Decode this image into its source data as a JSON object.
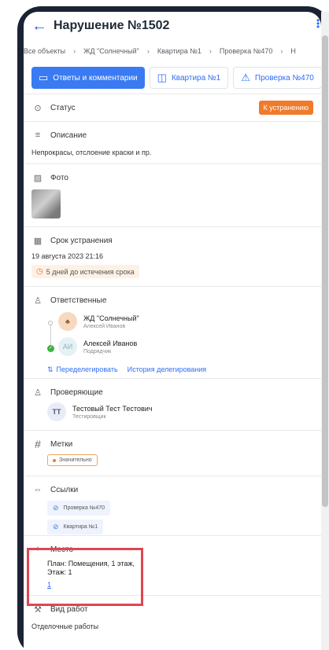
{
  "header": {
    "title": "Нарушение №1502"
  },
  "breadcrumb": [
    "Все объекты",
    "ЖД \"Солнечный\"",
    "Квартира №1",
    "Проверка №470",
    "Н"
  ],
  "tabs": [
    {
      "label": "Ответы и комментарии",
      "icon": "comment-icon"
    },
    {
      "label": "Квартира №1",
      "icon": "apartment-icon"
    },
    {
      "label": "Проверка №470",
      "icon": "inspection-icon"
    }
  ],
  "status": {
    "label": "Статус",
    "value": "К устранению",
    "color": "#f07a2b"
  },
  "description": {
    "label": "Описание",
    "text": "Непрокрасы, отслоение краски и пр."
  },
  "photo": {
    "label": "Фото"
  },
  "deadline": {
    "label": "Срок устранения",
    "date": "19 августа 2023 21:16",
    "remaining": "5 дней до истечения срока"
  },
  "responsible": {
    "label": "Ответственные",
    "people": [
      {
        "name": "ЖД \"Солнечный\"",
        "role": "Алексей Иванов",
        "initials": ""
      },
      {
        "name": "Алексей Иванов",
        "role": "Подрядчик",
        "initials": "АИ"
      }
    ],
    "redelegate": "Переделегировать",
    "history": "История делегирования"
  },
  "inspectors": {
    "label": "Проверяющие",
    "people": [
      {
        "name": "Тестовый Тест Тестович",
        "role": "Тестировщик",
        "initials": "ТТ"
      }
    ]
  },
  "tags": {
    "label": "Метки",
    "items": [
      "Значительно"
    ]
  },
  "links": {
    "label": "Ссылки",
    "items": [
      "Проверка №470",
      "Квартира №1"
    ]
  },
  "place": {
    "label": "Место",
    "text": "План: Помещения, 1 этаж, Этаж: 1",
    "link": "1"
  },
  "work_type": {
    "label": "Вид работ",
    "value": "Отделочные работы"
  }
}
